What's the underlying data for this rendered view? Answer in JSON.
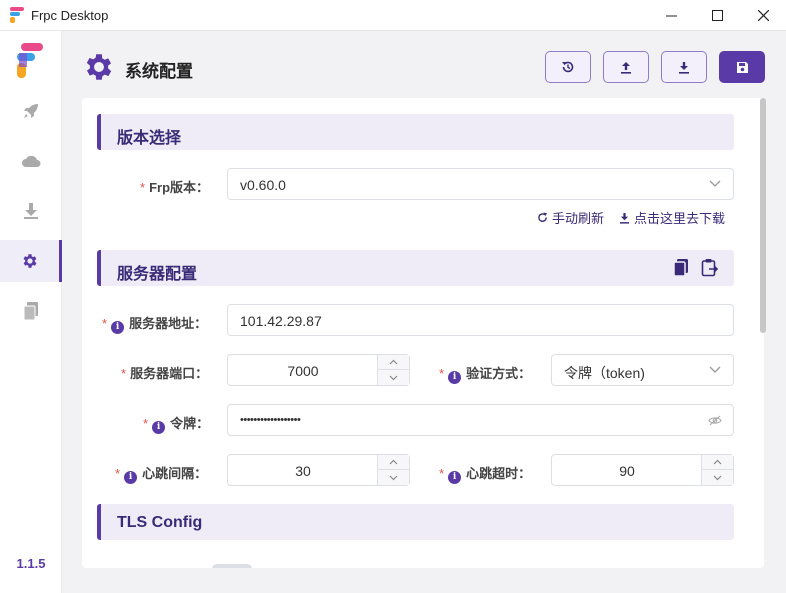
{
  "window": {
    "title": "Frpc Desktop"
  },
  "sidebar": {
    "version": "1.1.5"
  },
  "page": {
    "title": "系统配置"
  },
  "sections": {
    "version": {
      "title": "版本选择",
      "frp_version_label": "Frp版本：",
      "frp_version_value": "v0.60.0",
      "refresh_link": "手动刷新",
      "download_link": "点击这里去下载"
    },
    "server": {
      "title": "服务器配置",
      "address_label": "服务器地址：",
      "address_value": "101.42.29.87",
      "port_label": "服务器端口：",
      "port_value": "7000",
      "auth_label": "验证方式：",
      "auth_value": "令牌（token)",
      "token_label": "令牌：",
      "token_value": "••••••••••••••••••",
      "heartbeat_interval_label": "心跳间隔：",
      "heartbeat_interval_value": "30",
      "heartbeat_timeout_label": "心跳超时：",
      "heartbeat_timeout_value": "90"
    },
    "tls": {
      "title": "TLS Config"
    }
  },
  "required_mark": "*",
  "info_mark": "i",
  "colors": {
    "accent": "#5a3aa6",
    "section_bg": "#efecf7",
    "required": "#e0534b"
  }
}
